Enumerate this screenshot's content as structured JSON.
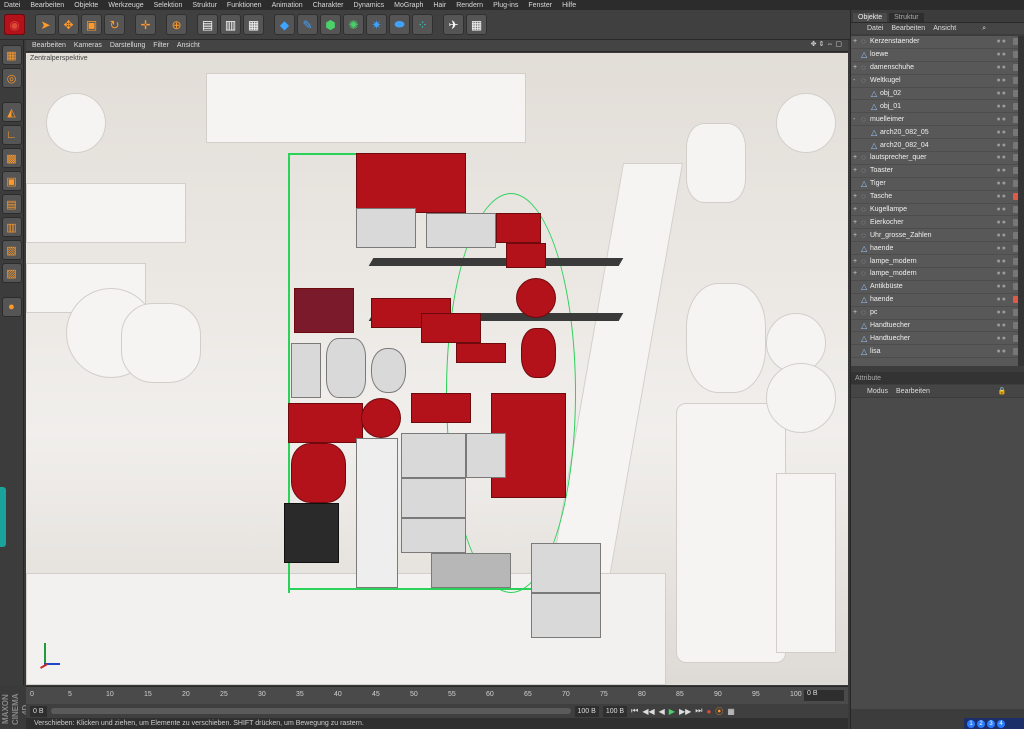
{
  "menubar": [
    "Datei",
    "Bearbeiten",
    "Objekte",
    "Werkzeuge",
    "Selektion",
    "Struktur",
    "Funktionen",
    "Animation",
    "Charakter",
    "Dynamics",
    "MoGraph",
    "Hair",
    "Rendern",
    "Plug-ins",
    "Fenster",
    "Hilfe"
  ],
  "viewport": {
    "menu": [
      "Bearbeiten",
      "Kameras",
      "Darstellung",
      "Filter",
      "Ansicht"
    ],
    "title": "Zentralperspektive"
  },
  "right_panel": {
    "tabs": [
      "Objekte",
      "Struktur"
    ],
    "menu": [
      "Datei",
      "Bearbeiten",
      "Ansicht"
    ],
    "objects": [
      {
        "name": "Kerzenstaender",
        "expand": "+",
        "icon": "null",
        "indent": 0
      },
      {
        "name": "loewe",
        "expand": "",
        "icon": "poly",
        "indent": 0
      },
      {
        "name": "damenschuhe",
        "expand": "+",
        "icon": "null",
        "indent": 0
      },
      {
        "name": "Weltkugel",
        "expand": "-",
        "icon": "null",
        "indent": 0
      },
      {
        "name": "obj_02",
        "expand": "",
        "icon": "poly",
        "indent": 1
      },
      {
        "name": "obj_01",
        "expand": "",
        "icon": "poly",
        "indent": 1
      },
      {
        "name": "muelleimer",
        "expand": "-",
        "icon": "null",
        "indent": 0
      },
      {
        "name": "arch20_082_05",
        "expand": "",
        "icon": "poly",
        "indent": 1
      },
      {
        "name": "arch20_082_04",
        "expand": "",
        "icon": "poly",
        "indent": 1
      },
      {
        "name": "lautsprecher_quer",
        "expand": "+",
        "icon": "null",
        "indent": 0
      },
      {
        "name": "Toaster",
        "expand": "+",
        "icon": "null",
        "indent": 0
      },
      {
        "name": "Tiger",
        "expand": "",
        "icon": "poly",
        "indent": 0
      },
      {
        "name": "Tasche",
        "expand": "+",
        "icon": "null",
        "indent": 0,
        "tag": "red"
      },
      {
        "name": "Kugellampe",
        "expand": "+",
        "icon": "null",
        "indent": 0
      },
      {
        "name": "Eierkocher",
        "expand": "+",
        "icon": "null",
        "indent": 0
      },
      {
        "name": "Uhr_grosse_Zahlen",
        "expand": "+",
        "icon": "null",
        "indent": 0
      },
      {
        "name": "haende",
        "expand": "",
        "icon": "poly",
        "indent": 0
      },
      {
        "name": "lampe_modern",
        "expand": "+",
        "icon": "null",
        "indent": 0
      },
      {
        "name": "lampe_modern",
        "expand": "+",
        "icon": "null",
        "indent": 0
      },
      {
        "name": "Antikbüste",
        "expand": "",
        "icon": "poly",
        "indent": 0
      },
      {
        "name": "haende",
        "expand": "",
        "icon": "poly",
        "indent": 0,
        "tag": "red"
      },
      {
        "name": "pc",
        "expand": "+",
        "icon": "null",
        "indent": 0
      },
      {
        "name": "Handtuecher",
        "expand": "",
        "icon": "poly",
        "indent": 0
      },
      {
        "name": "Handtuecher",
        "expand": "",
        "icon": "poly",
        "indent": 0
      },
      {
        "name": "lisa",
        "expand": "",
        "icon": "poly",
        "indent": 0
      }
    ],
    "attribute_label": "Attribute",
    "attribute_menu": [
      "Modus",
      "Bearbeiten"
    ]
  },
  "timeline": {
    "ticks": [
      "0",
      "5",
      "10",
      "15",
      "20",
      "25",
      "30",
      "35",
      "40",
      "45",
      "50",
      "55",
      "60",
      "65",
      "70",
      "75",
      "80",
      "85",
      "90",
      "95",
      "100"
    ],
    "end_frame": "0 B"
  },
  "transport": {
    "start": "0 B",
    "current": "100 B",
    "end": "100 B"
  },
  "status": "Verschieben: Klicken und ziehen, um Elemente zu verschieben. SHIFT drücken, um Bewegung zu rastern.",
  "branding": "MAXON CINEMA 4D",
  "accent": "#ff9a2a",
  "hud": [
    "1",
    "2",
    "3",
    "4"
  ]
}
